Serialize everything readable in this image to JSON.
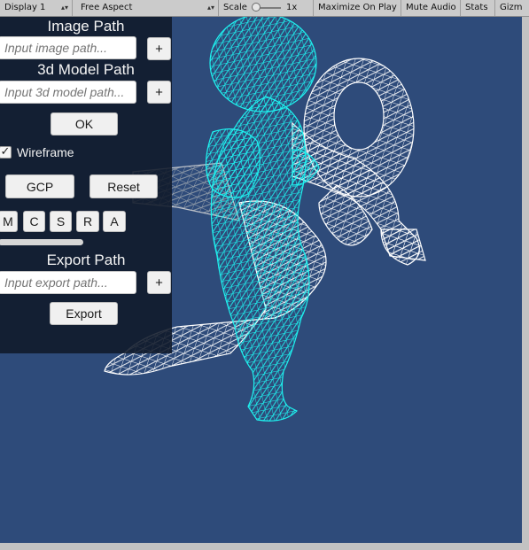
{
  "toolbar": {
    "display": "Display 1",
    "aspect": "Free Aspect",
    "scale_label": "Scale",
    "scale_value": "1x",
    "maximize": "Maximize On Play",
    "mute": "Mute Audio",
    "stats": "Stats",
    "gizmos": "Gizm"
  },
  "panel": {
    "image_path_label": "Image Path",
    "image_path_placeholder": "Input image path...",
    "image_add": "+",
    "model_path_label": "3d Model Path",
    "model_path_placeholder": "Input 3d model path...",
    "model_add": "+",
    "ok": "OK",
    "wireframe_label": "Wireframe",
    "wireframe_check": "✓",
    "gcp": "GCP",
    "reset": "Reset",
    "modes": [
      "M",
      "C",
      "S",
      "R",
      "A"
    ],
    "export_path_label": "Export Path",
    "export_path_placeholder": "Input export path...",
    "export_add": "+",
    "export": "Export"
  },
  "colors": {
    "viewport_bg": "#2e4b7a",
    "wire_cyan": "#1ef3f0",
    "wire_white": "#ffffff"
  }
}
